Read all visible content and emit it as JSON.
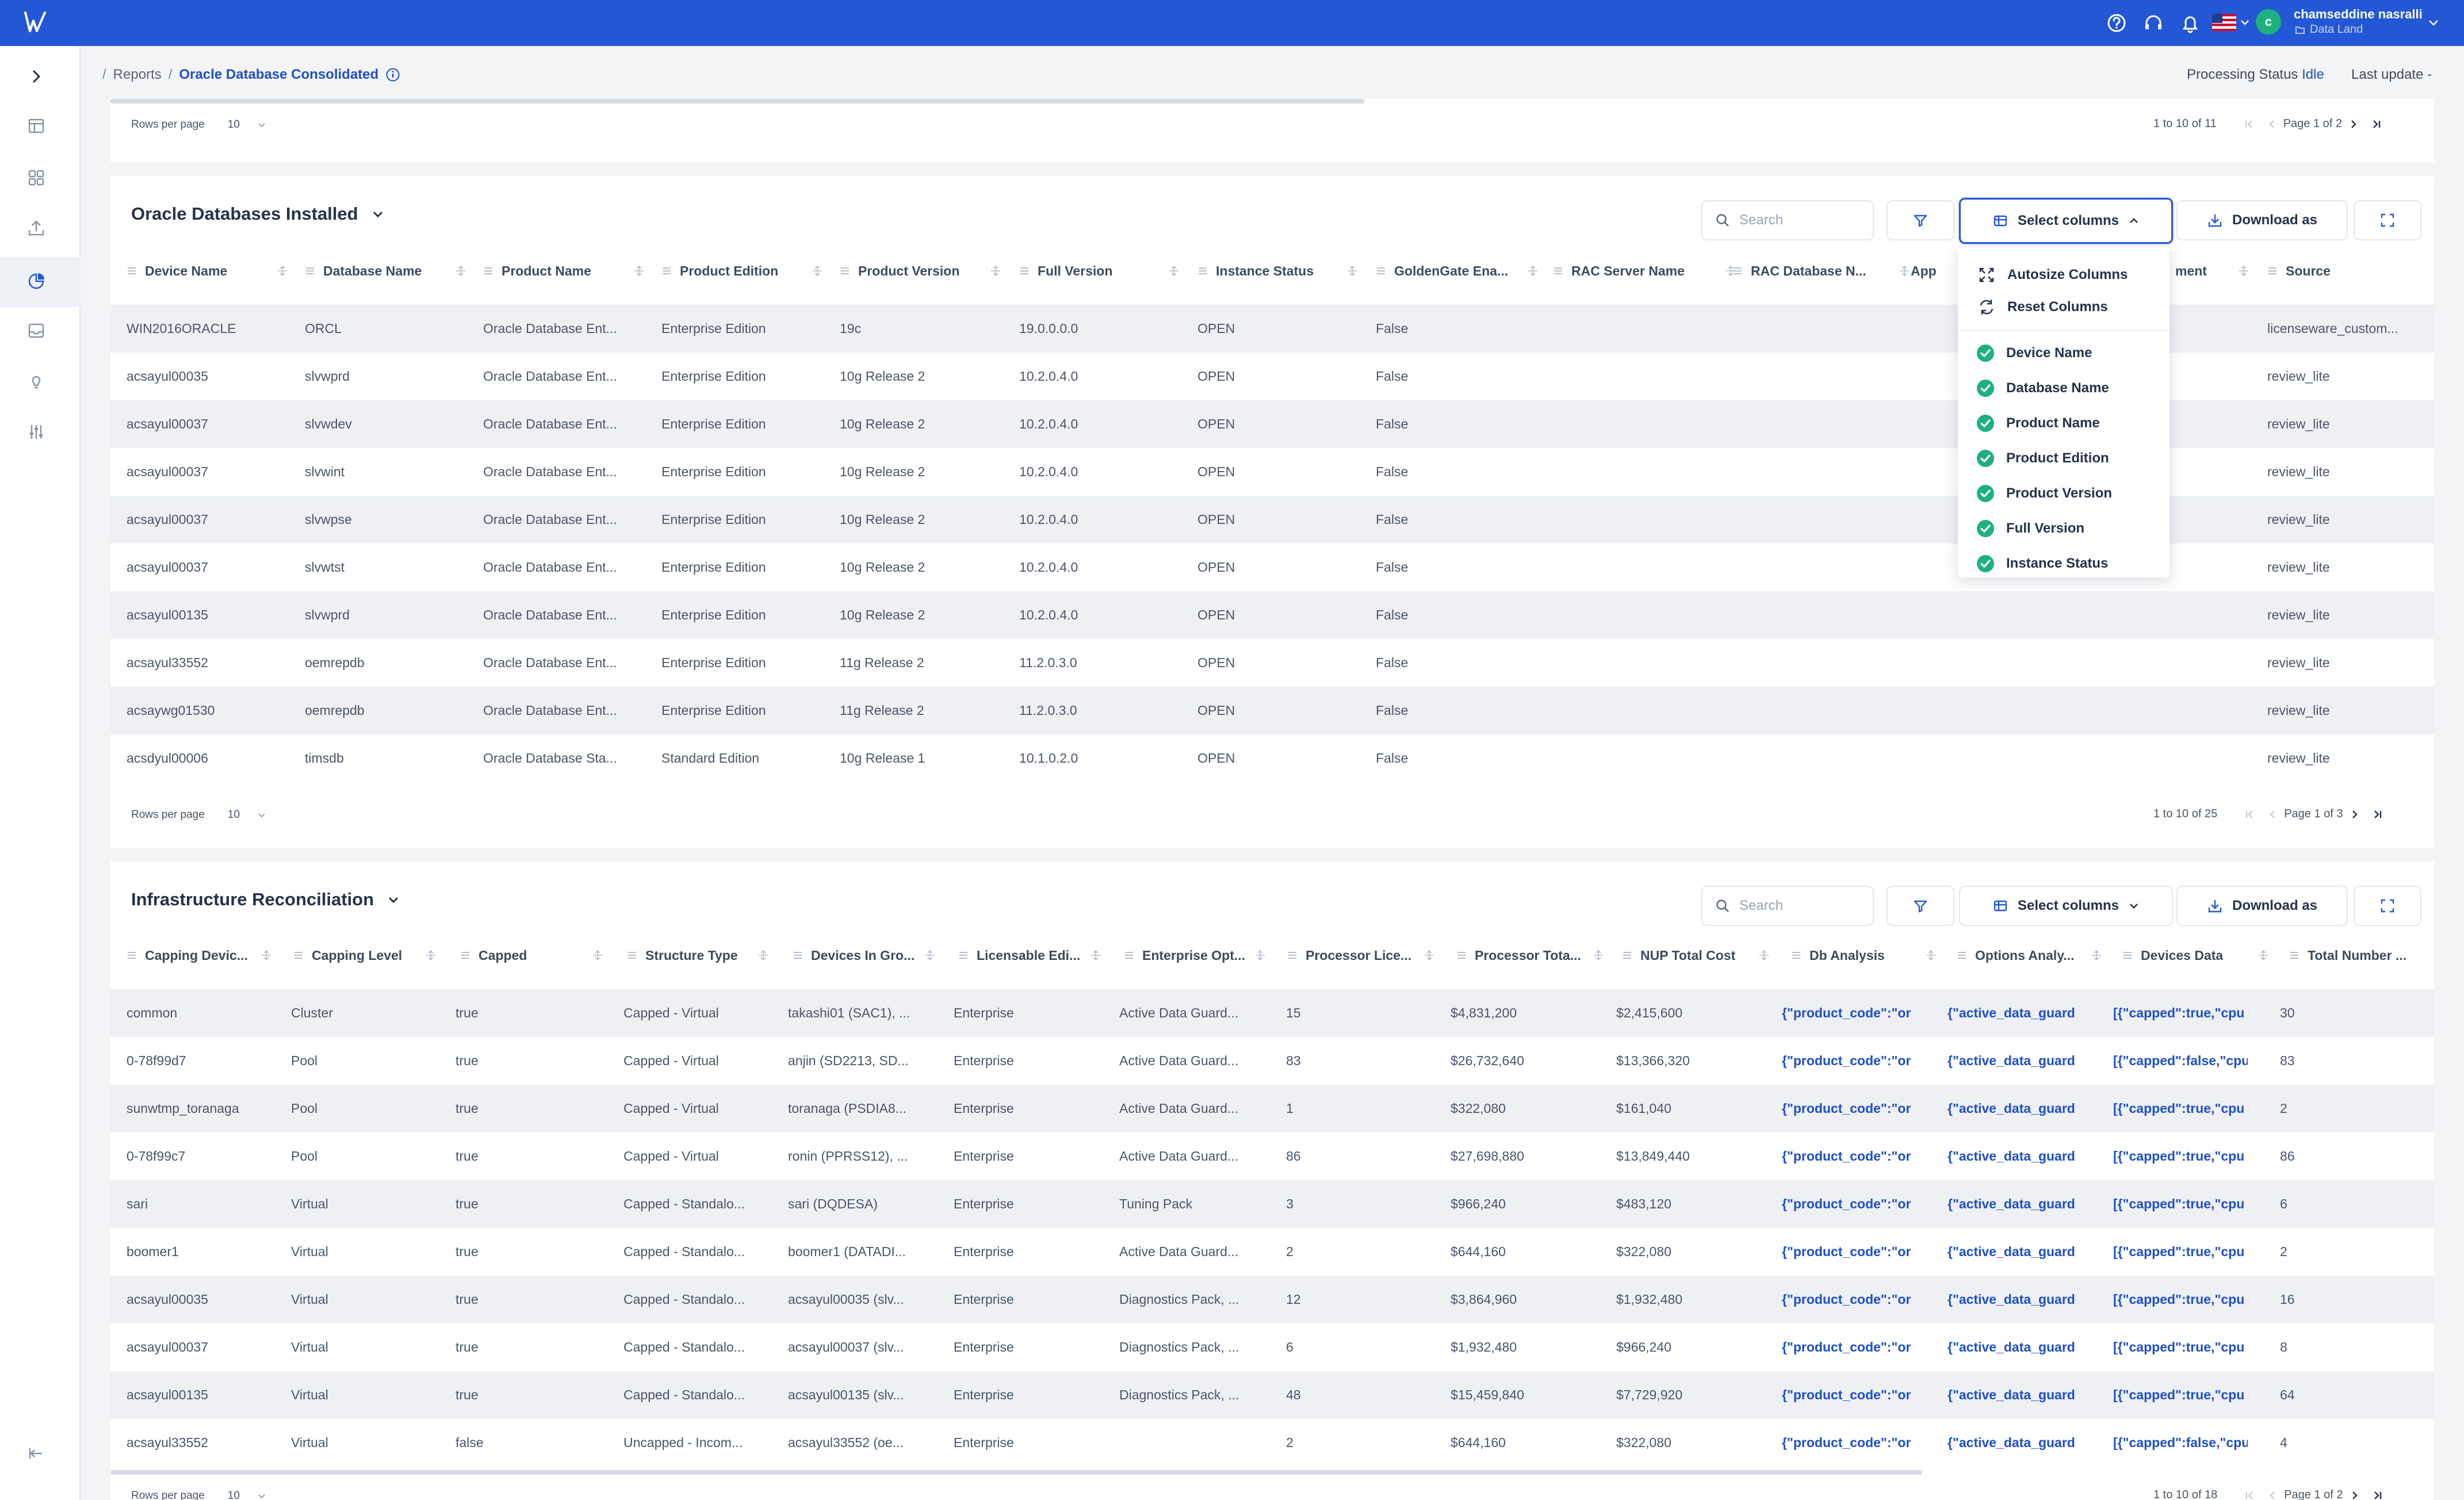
{
  "header": {
    "user_initial": "c",
    "user_name": "chamseddine nasralli",
    "org_name": "Data Land",
    "breadcrumb": [
      "Reports",
      "Oracle Database Consolidated"
    ],
    "processing_label": "Processing Status",
    "processing_value": "Idle",
    "last_update_label": "Last update -"
  },
  "common": {
    "rows_per_page_label": "Rows per page",
    "rows_per_page_value": "10",
    "search_placeholder": "Search",
    "select_columns": "Select columns",
    "download_as": "Download as"
  },
  "top_pager": {
    "range": "1 to 10 of 11",
    "page": "Page 1 of 2"
  },
  "oracle_table": {
    "title": "Oracle Databases Installed",
    "columns": [
      "Device Name",
      "Database Name",
      "Product Name",
      "Product Edition",
      "Product Version",
      "Full Version",
      "Instance Status",
      "GoldenGate Ena...",
      "RAC Server Name",
      "RAC Database N...",
      "App",
      "ment",
      "Source"
    ],
    "rows": [
      [
        "WIN2016ORACLE",
        "ORCL",
        "Oracle Database Ent...",
        "Enterprise Edition",
        "19c",
        "19.0.0.0.0",
        "OPEN",
        "False",
        "licenseware_custom..."
      ],
      [
        "acsayul00035",
        "slvwprd",
        "Oracle Database Ent...",
        "Enterprise Edition",
        "10g Release 2",
        "10.2.0.4.0",
        "OPEN",
        "False",
        "review_lite"
      ],
      [
        "acsayul00037",
        "slvwdev",
        "Oracle Database Ent...",
        "Enterprise Edition",
        "10g Release 2",
        "10.2.0.4.0",
        "OPEN",
        "False",
        "review_lite"
      ],
      [
        "acsayul00037",
        "slvwint",
        "Oracle Database Ent...",
        "Enterprise Edition",
        "10g Release 2",
        "10.2.0.4.0",
        "OPEN",
        "False",
        "review_lite"
      ],
      [
        "acsayul00037",
        "slvwpse",
        "Oracle Database Ent...",
        "Enterprise Edition",
        "10g Release 2",
        "10.2.0.4.0",
        "OPEN",
        "False",
        "review_lite"
      ],
      [
        "acsayul00037",
        "slvwtst",
        "Oracle Database Ent...",
        "Enterprise Edition",
        "10g Release 2",
        "10.2.0.4.0",
        "OPEN",
        "False",
        "review_lite"
      ],
      [
        "acsayul00135",
        "slvwprd",
        "Oracle Database Ent...",
        "Enterprise Edition",
        "10g Release 2",
        "10.2.0.4.0",
        "OPEN",
        "False",
        "review_lite"
      ],
      [
        "acsayul33552",
        "oemrepdb",
        "Oracle Database Ent...",
        "Enterprise Edition",
        "11g Release 2",
        "11.2.0.3.0",
        "OPEN",
        "False",
        "review_lite"
      ],
      [
        "acsaywg01530",
        "oemrepdb",
        "Oracle Database Ent...",
        "Enterprise Edition",
        "11g Release 2",
        "11.2.0.3.0",
        "OPEN",
        "False",
        "review_lite"
      ],
      [
        "acsdyul00006",
        "timsdb",
        "Oracle Database Sta...",
        "Standard Edition",
        "10g Release 1",
        "10.1.0.2.0",
        "OPEN",
        "False",
        "review_lite"
      ]
    ],
    "pager": {
      "range": "1 to 10 of 25",
      "page": "Page 1 of 3"
    }
  },
  "columns_menu": {
    "actions": [
      "Autosize Columns",
      "Reset Columns"
    ],
    "items": [
      "Device Name",
      "Database Name",
      "Product Name",
      "Product Edition",
      "Product Version",
      "Full Version",
      "Instance Status"
    ]
  },
  "infra_table": {
    "title": "Infrastructure Reconciliation",
    "columns": [
      "Capping Devic...",
      "Capping Level",
      "Capped",
      "Structure Type",
      "Devices In Gro...",
      "Licensable Edi...",
      "Enterprise Opt...",
      "Processor Lice...",
      "Processor Tota...",
      "NUP Total Cost",
      "Db Analysis",
      "Options Analy...",
      "Devices Data",
      "Total Number ..."
    ],
    "rows": [
      [
        "common",
        "Cluster",
        "true",
        "Capped - Virtual",
        "takashi01 (SAC1), ...",
        "Enterprise",
        "Active Data Guard...",
        "15",
        "$4,831,200",
        "$2,415,600",
        "{\"product_code\":\"or",
        "{\"active_data_guard",
        "[{\"capped\":true,\"cpu",
        "30"
      ],
      [
        "0-78f99d7",
        "Pool",
        "true",
        "Capped - Virtual",
        "anjin (SD2213, SD...",
        "Enterprise",
        "Active Data Guard...",
        "83",
        "$26,732,640",
        "$13,366,320",
        "{\"product_code\":\"or",
        "{\"active_data_guard",
        "[{\"capped\":false,\"cpu",
        "83"
      ],
      [
        "sunwtmp_toranaga",
        "Pool",
        "true",
        "Capped - Virtual",
        "toranaga (PSDIA8...",
        "Enterprise",
        "Active Data Guard...",
        "1",
        "$322,080",
        "$161,040",
        "{\"product_code\":\"or",
        "{\"active_data_guard",
        "[{\"capped\":true,\"cpu",
        "2"
      ],
      [
        "0-78f99c7",
        "Pool",
        "true",
        "Capped - Virtual",
        "ronin (PPRSS12), ...",
        "Enterprise",
        "Active Data Guard...",
        "86",
        "$27,698,880",
        "$13,849,440",
        "{\"product_code\":\"or",
        "{\"active_data_guard",
        "[{\"capped\":true,\"cpu",
        "86"
      ],
      [
        "sari",
        "Virtual",
        "true",
        "Capped - Standalo...",
        "sari (DQDESA)",
        "Enterprise",
        "Tuning Pack",
        "3",
        "$966,240",
        "$483,120",
        "{\"product_code\":\"or",
        "{\"active_data_guard",
        "[{\"capped\":true,\"cpu",
        "6"
      ],
      [
        "boomer1",
        "Virtual",
        "true",
        "Capped - Standalo...",
        "boomer1 (DATADI...",
        "Enterprise",
        "Active Data Guard...",
        "2",
        "$644,160",
        "$322,080",
        "{\"product_code\":\"or",
        "{\"active_data_guard",
        "[{\"capped\":true,\"cpu",
        "2"
      ],
      [
        "acsayul00035",
        "Virtual",
        "true",
        "Capped - Standalo...",
        "acsayul00035 (slv...",
        "Enterprise",
        "Diagnostics Pack, ...",
        "12",
        "$3,864,960",
        "$1,932,480",
        "{\"product_code\":\"or",
        "{\"active_data_guard",
        "[{\"capped\":true,\"cpu",
        "16"
      ],
      [
        "acsayul00037",
        "Virtual",
        "true",
        "Capped - Standalo...",
        "acsayul00037 (slv...",
        "Enterprise",
        "Diagnostics Pack, ...",
        "6",
        "$1,932,480",
        "$966,240",
        "{\"product_code\":\"or",
        "{\"active_data_guard",
        "[{\"capped\":true,\"cpu",
        "8"
      ],
      [
        "acsayul00135",
        "Virtual",
        "true",
        "Capped - Standalo...",
        "acsayul00135 (slv...",
        "Enterprise",
        "Diagnostics Pack, ...",
        "48",
        "$15,459,840",
        "$7,729,920",
        "{\"product_code\":\"or",
        "{\"active_data_guard",
        "[{\"capped\":true,\"cpu",
        "64"
      ],
      [
        "acsayul33552",
        "Virtual",
        "false",
        "Uncapped - Incom...",
        "acsayul33552 (oe...",
        "Enterprise",
        "",
        "2",
        "$644,160",
        "$322,080",
        "{\"product_code\":\"or",
        "{\"active_data_guard",
        "[{\"capped\":false,\"cpu",
        "4"
      ]
    ],
    "pager": {
      "range": "1 to 10 of 18",
      "page": "Page 1 of 2"
    }
  },
  "colors": {
    "brand": "#2457d6",
    "link": "#1f4fc8",
    "check": "#1fb07f"
  }
}
